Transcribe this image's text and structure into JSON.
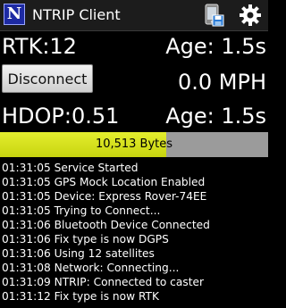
{
  "app": {
    "logo_letter": "N",
    "title": "NTRIP Client",
    "icons": [
      "save-to-phone-icon",
      "gear-icon"
    ]
  },
  "status": {
    "rtk": "RTK:12",
    "age_top": "Age: 1.5s",
    "disconnect_label": "Disconnect",
    "speed": "0.0 MPH",
    "hdop": "HDOP:0.51",
    "age_bottom": "Age: 1.5s"
  },
  "bytes": {
    "label": "10,513 Bytes",
    "progress": 0.62
  },
  "colors": {
    "background": "#000000",
    "progress_fill": "#d8e21e",
    "progress_track": "#9b9b9b",
    "logo_blue": "#1d2aa3"
  },
  "log": [
    "01:31:05 Service Started",
    "01:31:05 GPS Mock Location Enabled",
    "01:31:05 Device: Express Rover-74EE",
    "01:31:05 Trying to Connect...",
    "01:31:06 Bluetooth Device Connected",
    "01:31:06 Fix type is now DGPS",
    "01:31:06 Using 12 satellites",
    "01:31:08 Network: Connecting...",
    "01:31:09 NTRIP: Connected to caster",
    "01:31:12 Fix type is now RTK"
  ]
}
